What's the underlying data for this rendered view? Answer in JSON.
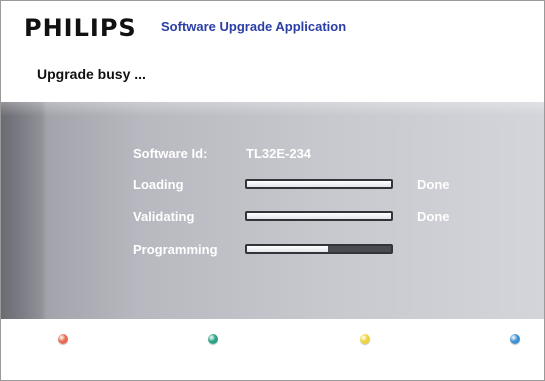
{
  "header": {
    "brand": "PHILIPS",
    "app_title": "Software Upgrade Application"
  },
  "status": {
    "text": "Upgrade busy ..."
  },
  "software": {
    "label": "Software Id:",
    "value": "TL32E-234"
  },
  "steps": [
    {
      "label": "Loading",
      "progress": 1.0,
      "status": "Done"
    },
    {
      "label": "Validating",
      "progress": 1.0,
      "status": "Done"
    },
    {
      "label": "Programming",
      "progress": 0.56,
      "status": ""
    }
  ],
  "color_keys": [
    {
      "name": "red",
      "color": "#e8694f"
    },
    {
      "name": "green",
      "color": "#27a383"
    },
    {
      "name": "yellow",
      "color": "#f0d23a"
    },
    {
      "name": "blue",
      "color": "#3d8fd1"
    }
  ],
  "colors": {
    "brand_text": "#111111",
    "title_text": "#2b3ea3",
    "panel_text": "#ffffff"
  }
}
